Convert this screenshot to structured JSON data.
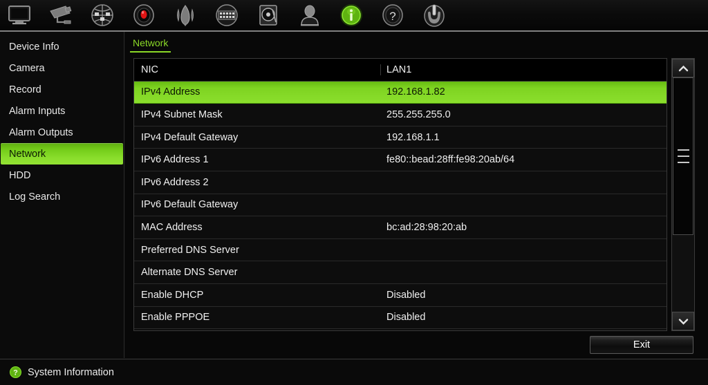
{
  "toolbar": {
    "items": [
      {
        "name": "monitor-icon",
        "label": "Display"
      },
      {
        "name": "camera-icon",
        "label": "Camera"
      },
      {
        "name": "network-globe-icon",
        "label": "Network"
      },
      {
        "name": "record-icon",
        "label": "Record"
      },
      {
        "name": "alarm-icon",
        "label": "Alarm"
      },
      {
        "name": "device-panel-icon",
        "label": "Device"
      },
      {
        "name": "hdd-icon",
        "label": "HDD"
      },
      {
        "name": "user-icon",
        "label": "User"
      },
      {
        "name": "info-icon",
        "label": "System Information"
      },
      {
        "name": "help-icon",
        "label": "Help"
      },
      {
        "name": "power-icon",
        "label": "Shutdown"
      }
    ],
    "active_index": 8
  },
  "sidebar": {
    "items": [
      {
        "label": "Device Info",
        "active": false
      },
      {
        "label": "Camera",
        "active": false
      },
      {
        "label": "Record",
        "active": false
      },
      {
        "label": "Alarm Inputs",
        "active": false
      },
      {
        "label": "Alarm Outputs",
        "active": false
      },
      {
        "label": "Network",
        "active": true
      },
      {
        "label": "HDD",
        "active": false
      },
      {
        "label": "Log Search",
        "active": false
      }
    ]
  },
  "content": {
    "tab_label": "Network",
    "table": {
      "header": {
        "key": "NIC",
        "value": "LAN1"
      },
      "rows": [
        {
          "key": "IPv4 Address",
          "value": "192.168.1.82",
          "selected": true
        },
        {
          "key": "IPv4 Subnet Mask",
          "value": "255.255.255.0",
          "selected": false
        },
        {
          "key": "IPv4 Default Gateway",
          "value": "192.168.1.1",
          "selected": false
        },
        {
          "key": "IPv6 Address 1",
          "value": "fe80::bead:28ff:fe98:20ab/64",
          "selected": false
        },
        {
          "key": "IPv6 Address 2",
          "value": "",
          "selected": false
        },
        {
          "key": "IPv6 Default Gateway",
          "value": "",
          "selected": false
        },
        {
          "key": "MAC Address",
          "value": "bc:ad:28:98:20:ab",
          "selected": false
        },
        {
          "key": "Preferred DNS Server",
          "value": "",
          "selected": false
        },
        {
          "key": "Alternate DNS Server",
          "value": "",
          "selected": false
        },
        {
          "key": "Enable DHCP",
          "value": "Disabled",
          "selected": false
        },
        {
          "key": "Enable PPPOE",
          "value": "Disabled",
          "selected": false
        },
        {
          "key": "",
          "value": "",
          "selected": false
        }
      ]
    },
    "scrollbar": {
      "up_icon": "chevron-up-icon",
      "down_icon": "chevron-down-icon"
    },
    "exit_label": "Exit"
  },
  "statusbar": {
    "icon": "help-circle-icon",
    "text": "System Information"
  },
  "colors": {
    "accent_green": "#7ed321",
    "tab_green": "#8bd927",
    "background": "#0a0a0a",
    "panel_border": "#3a3a3a",
    "text": "#f0f0f0"
  }
}
